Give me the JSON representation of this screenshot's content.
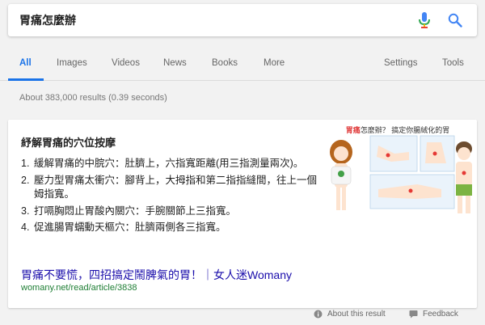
{
  "search": {
    "query": "胃痛怎麼辦"
  },
  "tabs": [
    {
      "label": "All",
      "active": true
    },
    {
      "label": "Images"
    },
    {
      "label": "Videos"
    },
    {
      "label": "News"
    },
    {
      "label": "Books"
    },
    {
      "label": "More"
    },
    {
      "label": "Settings"
    },
    {
      "label": "Tools"
    }
  ],
  "stats": "About 383,000 results (0.39 seconds)",
  "snippet": {
    "title": "紓解胃痛的穴位按摩",
    "steps": [
      {
        "num": "1.",
        "text": "緩解胃痛的中脘穴：肚臍上，六指寬距離(用三指測量兩次)。"
      },
      {
        "num": "2.",
        "text": "壓力型胃痛太衝穴：腳背上，大拇指和第二指指縫間，往上一個姆指寬。"
      },
      {
        "num": "3.",
        "text": "打嗝胸悶止胃酸內關穴：手腕關節上三指寬。"
      },
      {
        "num": "4.",
        "text": "促進腸胃蠕動天樞穴：肚臍兩側各三指寬。"
      }
    ],
    "image_caption_highlight": "胃痛",
    "image_caption_rest": "怎麼辦？ 搞定你腸絨化的胃",
    "result_title": "胃痛不要慌，四招搞定鬧脾氣的胃！｜女人迷Womany",
    "result_url": "womany.net/read/article/3838"
  },
  "footer": {
    "about": "About this result",
    "feedback": "Feedback"
  },
  "colors": {
    "accent": "#1a73e8",
    "link": "#1a0dab",
    "url": "#1e7e34",
    "background": "#f2f2f2"
  },
  "icons": [
    "microphone-icon",
    "search-icon",
    "about-icon",
    "feedback-icon"
  ]
}
